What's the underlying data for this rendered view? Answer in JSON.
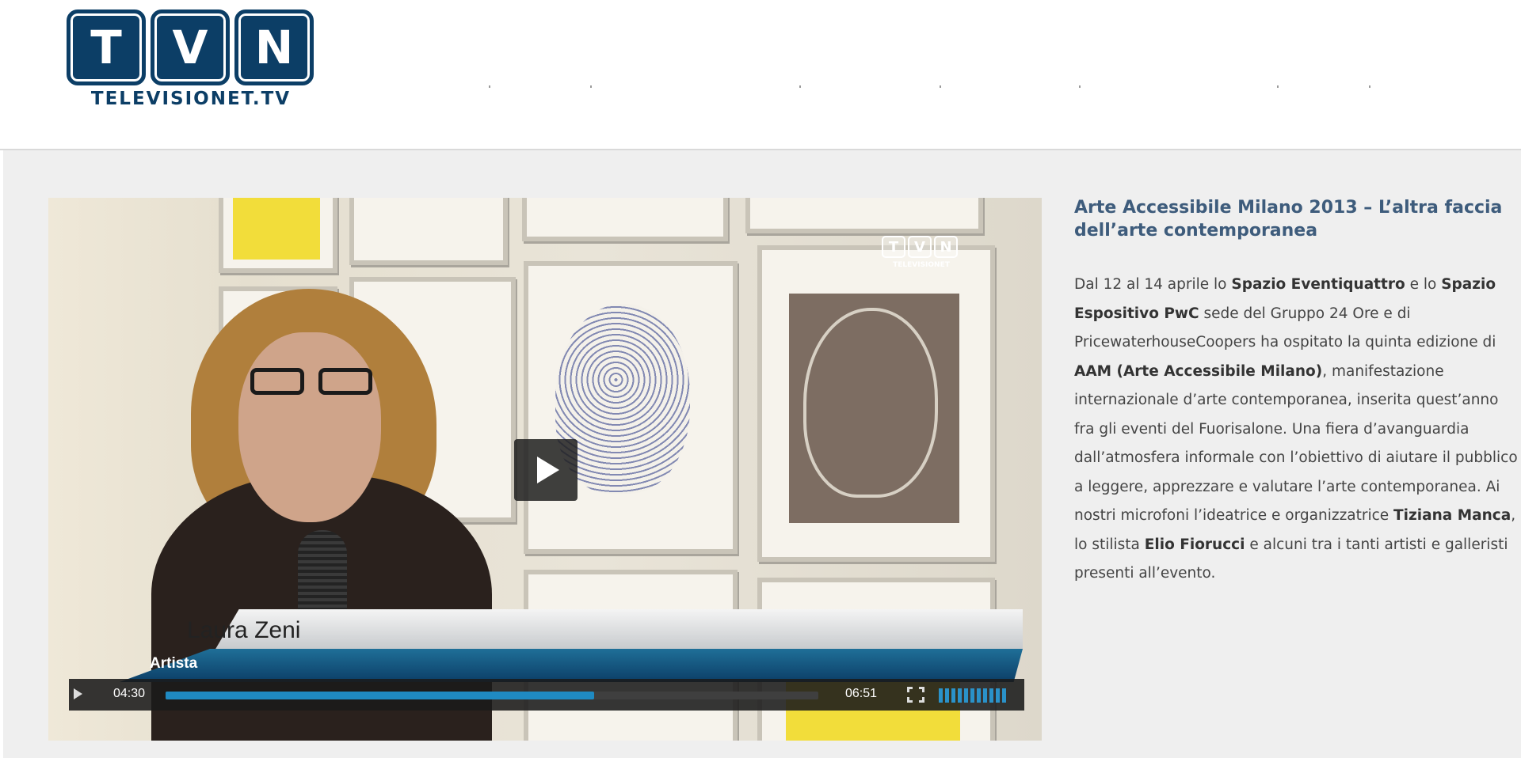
{
  "header": {
    "logo_letters": [
      "T",
      "V",
      "N"
    ],
    "logo_text": "TELEVISIONET.TV",
    "nav_separator": "·"
  },
  "video": {
    "watermark_letters": [
      "T",
      "V",
      "N"
    ],
    "watermark_text": "TELEVISIONET",
    "lower_third_name": "Laura Zeni",
    "lower_third_role": "Artista",
    "current_time": "04:30",
    "total_time": "06:51",
    "progress_fraction": 0.6569,
    "volume_bars": 11
  },
  "article": {
    "title": "Arte Accessibile Milano 2013 – L’altra faccia dell’arte contemporanea",
    "body": [
      {
        "text": "Dal 12 al 14 aprile lo ",
        "bold": false
      },
      {
        "text": "Spazio Eventiquattro",
        "bold": true
      },
      {
        "text": " e lo ",
        "bold": false
      },
      {
        "text": "Spazio Espositivo PwC",
        "bold": true
      },
      {
        "text": " sede del Gruppo 24 Ore e di PricewaterhouseCoopers ha ospitato la quinta edizione di ",
        "bold": false
      },
      {
        "text": "AAM (Arte Accessibile Milano)",
        "bold": true
      },
      {
        "text": ", manifestazione internazionale d’arte contemporanea, inserita quest’anno fra gli eventi del Fuorisalone. Una fiera d’avanguardia dall’atmosfera informale con l’obiettivo di aiutare il pubblico a leggere, apprezzare e valutare l’arte contemporanea. Ai nostri microfoni l’ideatrice e organizzatrice ",
        "bold": false
      },
      {
        "text": "Tiziana Manca",
        "bold": true
      },
      {
        "text": ", lo stilista ",
        "bold": false
      },
      {
        "text": "Elio Fiorucci",
        "bold": true
      },
      {
        "text": " e alcuni tra i tanti artisti e galleristi presenti all’evento.",
        "bold": false
      }
    ]
  },
  "colors": {
    "brand": "#0c3e66",
    "title": "#3e5c7c",
    "progress": "#1f8ac2",
    "background": "#efefef"
  }
}
